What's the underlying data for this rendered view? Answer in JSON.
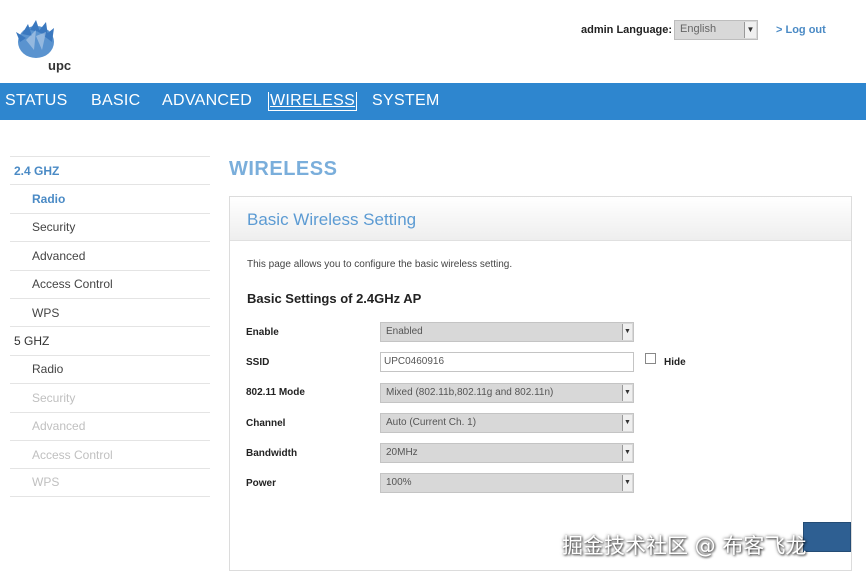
{
  "header": {
    "logo_text": "upc",
    "admin_label": "admin Language:",
    "language_selected": "English",
    "logout_label": "> Log out"
  },
  "nav": {
    "items": [
      "STATUS",
      "BASIC",
      "ADVANCED",
      "WIRELESS",
      "SYSTEM"
    ],
    "active": "WIRELESS"
  },
  "sidebar": {
    "band1": "2.4 GHZ",
    "band1_items": [
      "Radio",
      "Security",
      "Advanced",
      "Access Control",
      "WPS"
    ],
    "band2": "5 GHZ",
    "band2_items": [
      "Radio",
      "Security",
      "Advanced",
      "Access Control",
      "WPS"
    ]
  },
  "main": {
    "page_title": "WIRELESS",
    "panel_title": "Basic Wireless Setting",
    "description": "This page allows you to configure the basic wireless setting.",
    "section_title": "Basic Settings of 2.4GHz AP",
    "fields": {
      "enable_label": "Enable",
      "enable_value": "Enabled",
      "ssid_label": "SSID",
      "ssid_value": "UPC0460916",
      "hide_label": "Hide",
      "mode_label": "802.11 Mode",
      "mode_value": "Mixed (802.11b,802.11g and 802.11n)",
      "channel_label": "Channel",
      "channel_value": "Auto (Current Ch. 1)",
      "bandwidth_label": "Bandwidth",
      "bandwidth_value": "20MHz",
      "power_label": "Power",
      "power_value": "100%"
    }
  },
  "watermark": "掘金技术社区 @ 布客飞龙",
  "colors": {
    "nav_bg": "#2e86cf",
    "accent": "#4a8ac5",
    "title": "#7aaedb"
  }
}
